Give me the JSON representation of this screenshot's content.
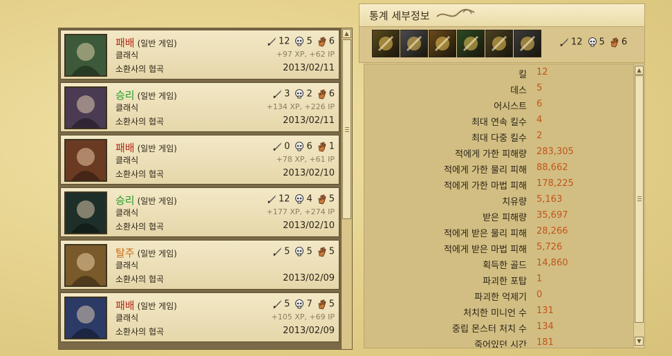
{
  "matches": [
    {
      "result": "패배",
      "result_class": "res-defeat",
      "mode": "(일반 게임)",
      "type": "클래식",
      "map": "소환사의 협곡",
      "kills": "12",
      "deaths": "5",
      "assists": "6",
      "rewards": "+97 XP, +62 IP",
      "date": "2013/02/11",
      "portrait_color": "#3c5a3a",
      "portrait_icon": "champion-gold-armor"
    },
    {
      "result": "승리",
      "result_class": "res-victory",
      "mode": "(일반 게임)",
      "type": "클래식",
      "map": "소환사의 협곡",
      "kills": "3",
      "deaths": "2",
      "assists": "6",
      "rewards": "+134 XP, +226 IP",
      "date": "2013/02/11",
      "portrait_color": "#4a3a52",
      "portrait_icon": "champion-wolf"
    },
    {
      "result": "패배",
      "result_class": "res-defeat",
      "mode": "(일반 게임)",
      "type": "클래식",
      "map": "소환사의 협곡",
      "kills": "0",
      "deaths": "6",
      "assists": "1",
      "rewards": "+78 XP, +61 IP",
      "date": "2013/02/10",
      "portrait_color": "#6b3a22",
      "portrait_icon": "champion-bearded"
    },
    {
      "result": "승리",
      "result_class": "res-victory",
      "mode": "(일반 게임)",
      "type": "클래식",
      "map": "소환사의 협곡",
      "kills": "12",
      "deaths": "4",
      "assists": "5",
      "rewards": "+177 XP, +274 IP",
      "date": "2013/02/10",
      "portrait_color": "#1e2f2a",
      "portrait_icon": "champion-mask"
    },
    {
      "result": "탈주",
      "result_class": "res-leave",
      "mode": "(일반 게임)",
      "type": "클래식",
      "map": "소환사의 협곡",
      "kills": "5",
      "deaths": "5",
      "assists": "5",
      "rewards": "",
      "date": "2013/02/09",
      "portrait_color": "#7a5a2a",
      "portrait_icon": "champion-scout"
    },
    {
      "result": "패배",
      "result_class": "res-defeat",
      "mode": "(일반 게임)",
      "type": "클래식",
      "map": "소환사의 협곡",
      "kills": "5",
      "deaths": "7",
      "assists": "5",
      "rewards": "+105 XP, +69 IP",
      "date": "2013/02/09",
      "portrait_color": "#2c3a66",
      "portrait_icon": "champion-archer"
    }
  ],
  "detail": {
    "title": "통계 세부정보",
    "kills": "12",
    "deaths": "5",
    "assists": "6",
    "items": [
      {
        "icon": "item-lantern",
        "color": "#5a4a1a"
      },
      {
        "icon": "item-helmet",
        "color": "#4a4a52"
      },
      {
        "icon": "item-blade",
        "color": "#6b4a1a"
      },
      {
        "icon": "item-green-bow",
        "color": "#2a4a22"
      },
      {
        "icon": "item-gold-wing",
        "color": "#4a4020"
      },
      {
        "icon": "item-gauntlet",
        "color": "#3a3a3a"
      }
    ],
    "stats": [
      {
        "label": "킬",
        "value": "12"
      },
      {
        "label": "데스",
        "value": "5"
      },
      {
        "label": "어시스트",
        "value": "6"
      },
      {
        "label": "최대 연속 킬수",
        "value": "4"
      },
      {
        "label": "최대 다중 킬수",
        "value": "2"
      },
      {
        "label": "적에게 가한 피해량",
        "value": "283,305"
      },
      {
        "label": "적에게 가한 물리 피해",
        "value": "88,662"
      },
      {
        "label": "적에게 가한 마법 피해",
        "value": "178,225"
      },
      {
        "label": "치유량",
        "value": "5,163"
      },
      {
        "label": "받은 피해량",
        "value": "35,697"
      },
      {
        "label": "적에게 받은 물리 피해",
        "value": "28,266"
      },
      {
        "label": "적에게 받은 마법 피해",
        "value": "5,726"
      },
      {
        "label": "획득한 골드",
        "value": "14,860"
      },
      {
        "label": "파괴한 포탑",
        "value": "1"
      },
      {
        "label": "파괴한 억제기",
        "value": "0"
      },
      {
        "label": "처치한 미니언 수",
        "value": "131"
      },
      {
        "label": "중립 몬스터 처치 수",
        "value": "134"
      },
      {
        "label": "죽어있던 시간",
        "value": "181"
      }
    ]
  }
}
